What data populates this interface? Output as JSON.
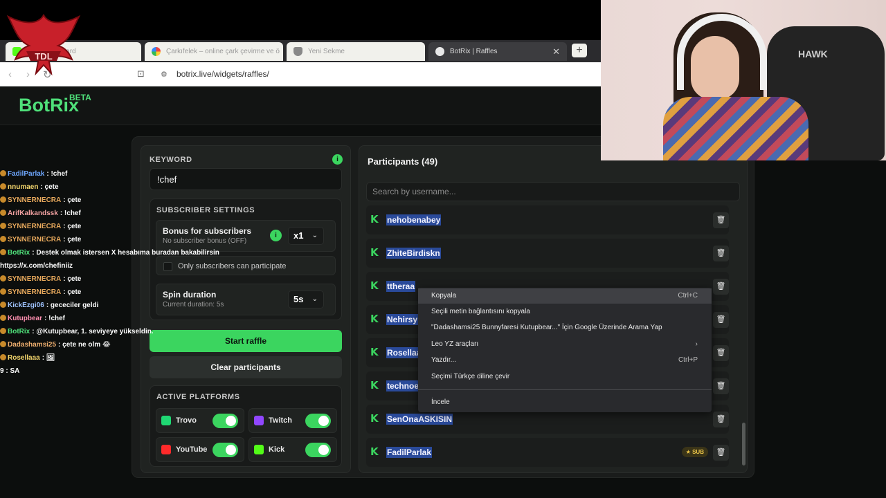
{
  "browser": {
    "tabs": [
      {
        "label": "Kick Dashboard",
        "active": false
      },
      {
        "label": "Çarkıfelek – online çark çevirme ve ö",
        "active": false
      },
      {
        "label": "Yeni Sekme",
        "active": false
      },
      {
        "label": "BotRix | Raffles",
        "active": true
      }
    ],
    "url": "botrix.live/widgets/raffles/",
    "new_tab": "+",
    "close_tab": "✕"
  },
  "app": {
    "brand": "BotRix",
    "badge": "BETA"
  },
  "chat": [
    {
      "user": "FadilParlak",
      "msg": ": !chef",
      "color": "#6fa8ff"
    },
    {
      "user": "nnumaen",
      "msg": ": çete",
      "color": "#f5d76e"
    },
    {
      "user": "SYNNERNECRA",
      "msg": ": çete",
      "color": "#e6a85c"
    },
    {
      "user": "ArifKalkandssk",
      "msg": ": !chef",
      "color": "#f0a0a0"
    },
    {
      "user": "SYNNERNECRA",
      "msg": ": çete",
      "color": "#e6a85c"
    },
    {
      "user": "SYNNERNECRA",
      "msg": ": çete",
      "color": "#e6a85c"
    },
    {
      "user": "BotRix",
      "msg": ": Destek olmak istersen X hesabıma buradan bakabilirsin",
      "color": "#4fe07a"
    },
    {
      "user": "",
      "msg": "https://x.com/chefiniiz",
      "color": "#ffffff"
    },
    {
      "user": "SYNNERNECRA",
      "msg": ": çete",
      "color": "#e6a85c"
    },
    {
      "user": "SYNNERNECRA",
      "msg": ": çete",
      "color": "#e6a85c"
    },
    {
      "user": "KickEzgi06",
      "msg": ": gececiler geldi",
      "color": "#a0c4ff"
    },
    {
      "user": "Kutupbear",
      "msg": ": !chef",
      "color": "#ff8fb0"
    },
    {
      "user": "BotRix",
      "msg": ": @Kutupbear, 1. seviyeye yükseldin.",
      "color": "#4fe07a"
    },
    {
      "user": "Dadashamsi25",
      "msg": ": çete ne olm 😂",
      "color": "#f0b070"
    },
    {
      "user": "Rosellaaa",
      "msg": ": 🖼",
      "color": "#f5d76e"
    },
    {
      "user": "",
      "msg": "9 : SA",
      "color": "#ffffff"
    }
  ],
  "settings": {
    "keyword_label": "KEYWORD",
    "keyword_value": "!chef",
    "subscriber_title": "SUBSCRIBER SETTINGS",
    "bonus_label": "Bonus for subscribers",
    "bonus_sub": "No subscriber bonus (OFF)",
    "bonus_value": "x1",
    "only_subs_label": "Only subscribers can participate",
    "spin_label": "Spin duration",
    "spin_sub": "Current duration: 5s",
    "spin_value": "5s",
    "start_button": "Start raffle",
    "clear_button": "Clear participants",
    "platforms_title": "ACTIVE PLATFORMS",
    "platforms": [
      {
        "name": "Trovo",
        "on": true,
        "color": "#1fd873"
      },
      {
        "name": "Twitch",
        "on": true,
        "color": "#9147ff"
      },
      {
        "name": "YouTube",
        "on": true,
        "color": "#ff2a2a"
      },
      {
        "name": "Kick",
        "on": true,
        "color": "#53fc18"
      }
    ]
  },
  "participants": {
    "title": "Participants (49)",
    "search_placeholder": "Search by username...",
    "list": [
      {
        "name": "nehobenabey",
        "sub": false
      },
      {
        "name": "ZhiteBirdiskn",
        "sub": false
      },
      {
        "name": "ttheraa",
        "sub": false
      },
      {
        "name": "Nehirsy",
        "sub": false
      },
      {
        "name": "Rosellaa",
        "sub": false
      },
      {
        "name": "technoe",
        "sub": false
      },
      {
        "name": "SenOnaASKISIN",
        "sub": false
      },
      {
        "name": "FadilParlak",
        "sub": true
      }
    ],
    "sub_badge": "★ SUB"
  },
  "context_menu": [
    {
      "label": "Kopyala",
      "shortcut": "Ctrl+C"
    },
    {
      "label": "Seçili metin bağlantısını kopyala",
      "shortcut": ""
    },
    {
      "label": "\"Dadashamsi25  Bunnyfaresi  Kutupbear...\" İçin Google Üzerinde Arama Yap",
      "shortcut": ""
    },
    {
      "label": "Leo YZ araçları",
      "shortcut": "›"
    },
    {
      "label": "Yazdır...",
      "shortcut": "Ctrl+P"
    },
    {
      "label": "Seçimi Türkçe diline çevir",
      "shortcut": ""
    },
    {
      "label": "İncele",
      "shortcut": ""
    }
  ],
  "webcam": {
    "chair_brand": "HAWK"
  },
  "colors": {
    "accent": "#3bd55f",
    "brand": "#4fe07a",
    "panel": "#202321"
  }
}
